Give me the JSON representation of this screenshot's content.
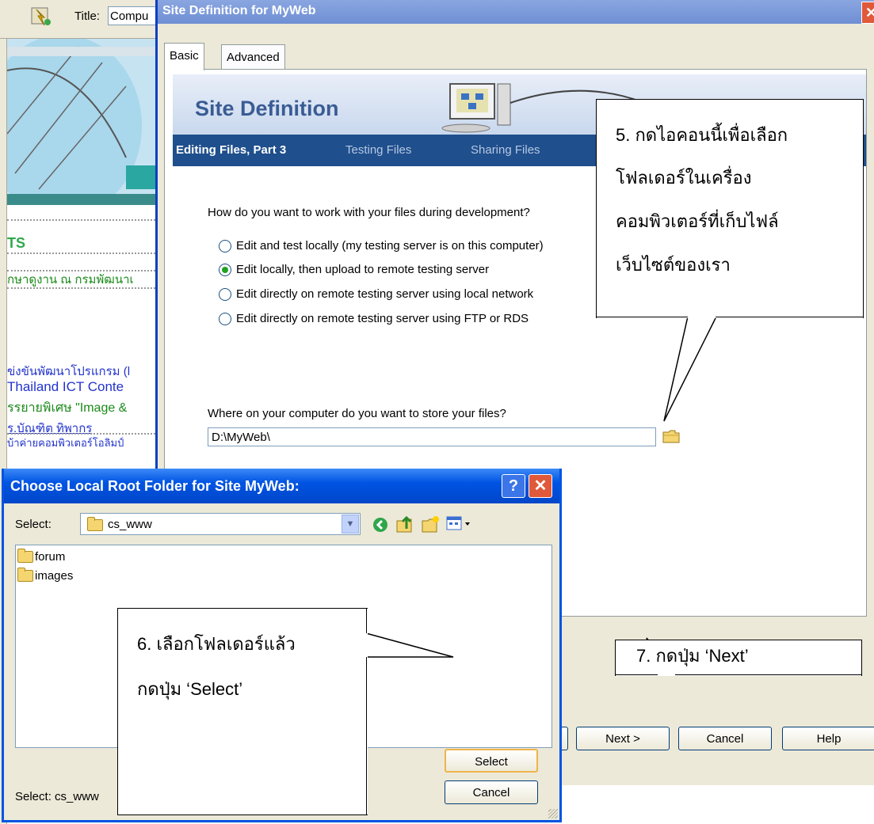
{
  "background": {
    "toolbar_title_label": "Title:",
    "toolbar_title_value": "Compu",
    "heading_fragment": "TS",
    "news_links": [
      "กษาดูงาน ณ กรมพัฒนาเ",
      "ข่งขันพัฒนาโปรแกรม (l",
      "Thailand ICT Conte",
      "รรยายพิเศษ \"Image &",
      "ร.บัณฑิต ทิพากร",
      "บ้าค่ายคอมพิวเตอร์โอลิมป์"
    ]
  },
  "site_dialog": {
    "title": "Site Definition for MyWeb",
    "close": "✕",
    "tabs": [
      "Basic",
      "Advanced"
    ],
    "banner_title": "Site Definition",
    "steps": {
      "current": "Editing Files, Part 3",
      "next1": "Testing Files",
      "next2": "Sharing Files"
    },
    "question": "How do you want to work with your files during development?",
    "options": [
      "Edit and test locally (my testing server is on this computer)",
      "Edit locally, then upload to remote testing server",
      "Edit directly on remote testing server using local network",
      "Edit directly on remote testing server using FTP or RDS"
    ],
    "selected_option": 1,
    "folder_question": "Where on your computer do you want to store your files?",
    "folder_path": "D:\\MyWeb\\",
    "buttons": {
      "next": "Next >",
      "cancel": "Cancel",
      "help": "Help"
    }
  },
  "folder_dialog": {
    "title": "Choose Local Root Folder for Site MyWeb:",
    "help_button": "?",
    "close_button": "✕",
    "select_label": "Select:",
    "select_value": "cs_www",
    "items": [
      "forum",
      "images"
    ],
    "status_text": "Select: cs_www",
    "buttons": {
      "select": "Select",
      "cancel": "Cancel"
    }
  },
  "callouts": {
    "callout5": [
      "5.  กดไอคอนนี้เพื่อเลือก",
      "โฟลเดอร์ในเครื่อง",
      "คอมพิวเตอร์ที่เก็บไฟล์",
      "เว็บไซต์ของเรา"
    ],
    "callout6": [
      "6.  เลือกโฟลเดอร์แล้ว",
      "กดปุ่ม ‘Select’"
    ],
    "callout7": [
      "7.  กดปุ่ม ‘Next’"
    ]
  },
  "colors": {
    "xp_blue": "#0054e3",
    "step_bar": "#1f4f8c",
    "news_green": "#1a8a1a",
    "news_blue": "#2233cc"
  }
}
